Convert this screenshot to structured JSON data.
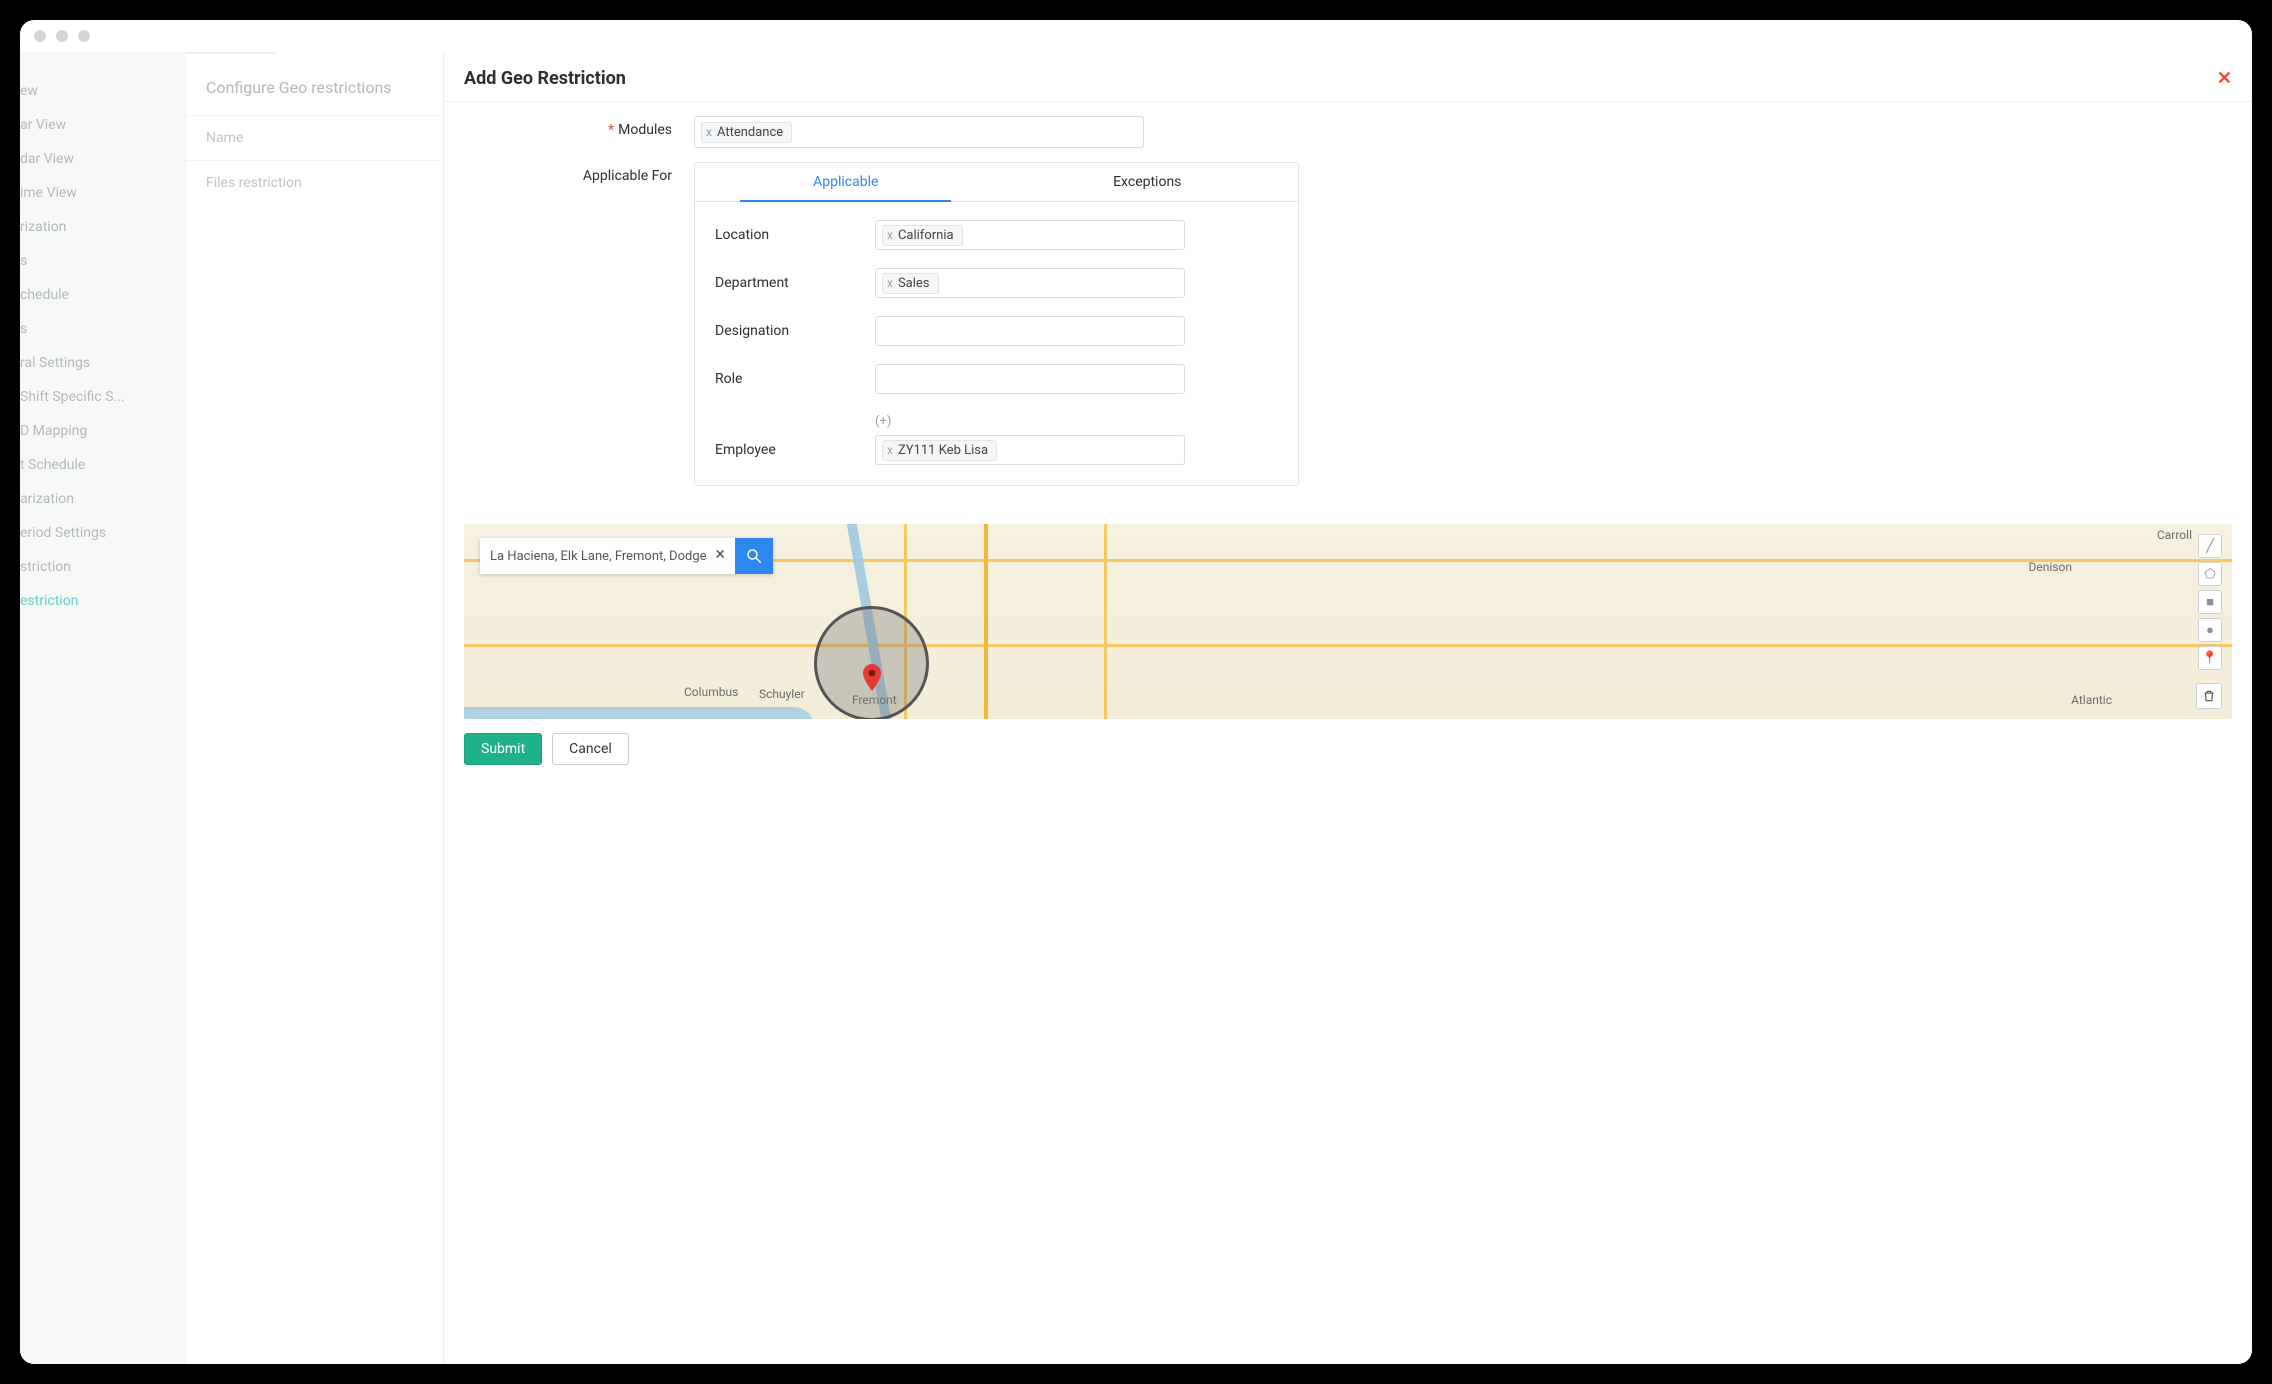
{
  "sidebar": {
    "items": [
      "ew",
      "ar View",
      "dar View",
      "ime View",
      "rization",
      "s",
      "chedule",
      "s",
      "ral Settings",
      "Shift Specific S...",
      "D Mapping",
      "t Schedule",
      "arization",
      "eriod Settings",
      "striction",
      "estriction"
    ],
    "activeIndex": 15
  },
  "midpanel": {
    "heading": "Configure Geo restrictions",
    "column": "Name",
    "row0": "Files restriction"
  },
  "modal": {
    "title": "Add Geo Restriction",
    "modulesLabel": "Modules",
    "modulesTag": "Attendance",
    "applicableForLabel": "Applicable For",
    "tabs": {
      "applicable": "Applicable",
      "exceptions": "Exceptions"
    },
    "fields": {
      "location": {
        "label": "Location",
        "tag": "California"
      },
      "department": {
        "label": "Department",
        "tag": "Sales"
      },
      "designation": {
        "label": "Designation"
      },
      "role": {
        "label": "Role"
      },
      "plus": "(+)",
      "employee": {
        "label": "Employee",
        "tag": "ZY111 Keb Lisa"
      }
    },
    "map": {
      "searchValue": "La Haciena, Elk Lane, Fremont, Dodge County,",
      "labels": {
        "carroll": "Carroll",
        "denison": "Denison",
        "atlantic": "Atlantic",
        "columbus": "Columbus",
        "schuyler": "Schuyler",
        "fremont": "Fremont"
      }
    },
    "buttons": {
      "submit": "Submit",
      "cancel": "Cancel"
    }
  }
}
